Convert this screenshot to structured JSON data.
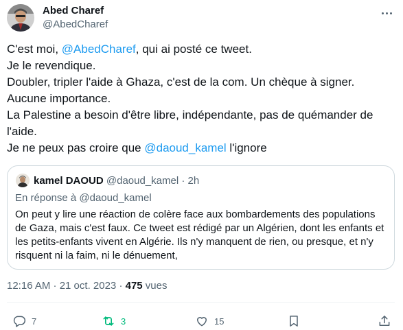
{
  "author": {
    "name": "Abed Charef",
    "handle": "@AbedCharef"
  },
  "tweet": {
    "p1_before": "C'est moi, ",
    "p1_mention": "@AbedCharef",
    "p1_after": ", qui ai posté ce tweet.\nJe le revendique.\nDoubler, tripler l'aide à Ghaza, c'est de la com. Un chèque à signer.\nAucune importance.\nLa Palestine a besoin d'être libre, indépendante, pas de quémander de l'aide.\nJe ne peux pas croire que ",
    "p2_mention": "@daoud_kamel",
    "p2_after": " l'ignore"
  },
  "quote": {
    "name": "kamel DAOUD",
    "meta": " @daoud_kamel · 2h",
    "reply_to": "En réponse à @daoud_kamel",
    "text": "On peut y lire une réaction de colère face aux bombardements des populations de Gaza, mais c'est faux. Ce tweet est rédigé par un Algérien, dont les enfants et les petits-enfants vivent en Algérie. Ils n'y manquent de rien, ou presque, et n'y risquent ni la faim, ni le dénuement,"
  },
  "meta": {
    "time_date": "12:16 AM · 21 oct. 2023 · ",
    "views_count": "475",
    "views_label": " vues"
  },
  "actions": {
    "replies": "7",
    "reposts": "3",
    "likes": "15"
  },
  "colors": {
    "accent": "#1d9bf0",
    "repost": "#00ba7c",
    "muted": "#536471",
    "text": "#0f1419"
  },
  "icons": [
    "more-icon",
    "reply-icon",
    "repost-icon",
    "like-icon",
    "bookmark-icon",
    "share-icon"
  ]
}
